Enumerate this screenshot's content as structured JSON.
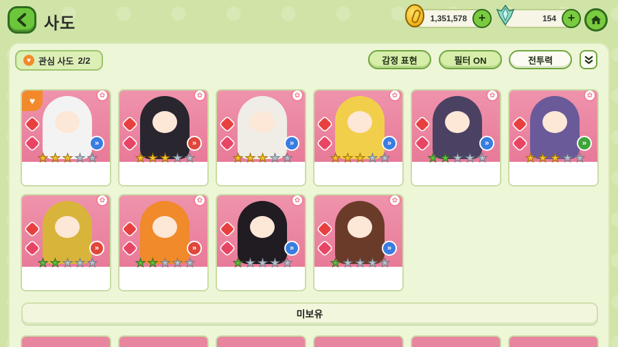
{
  "header": {
    "title": "사도",
    "coins": "1,351,578",
    "gems": "154",
    "plus_label": "+"
  },
  "toolbar": {
    "favorites_label": "관심 사도",
    "favorites_count": "2/2",
    "emotion_button": "감정 표현",
    "filter_button": "필터 ON",
    "power_button": "전투력"
  },
  "cards": [
    {
      "name": "",
      "stars": 3,
      "star_color": "gold",
      "favorite": true,
      "arrow": "blue"
    },
    {
      "name": "",
      "stars": 3,
      "star_color": "gold",
      "favorite": false,
      "arrow": "red"
    },
    {
      "name": "",
      "stars": 3,
      "star_color": "gold",
      "favorite": false,
      "arrow": "blue"
    },
    {
      "name": "",
      "stars": 3,
      "star_color": "gold",
      "favorite": false,
      "arrow": "blue"
    },
    {
      "name": "",
      "stars": 2,
      "star_color": "green",
      "favorite": false,
      "arrow": "blue"
    },
    {
      "name": "",
      "stars": 3,
      "star_color": "gold",
      "favorite": false,
      "arrow": "green"
    },
    {
      "name": "",
      "stars": 2,
      "star_color": "green",
      "favorite": false,
      "arrow": "red"
    },
    {
      "name": "",
      "stars": 2,
      "star_color": "green",
      "favorite": false,
      "arrow": "red"
    },
    {
      "name": "",
      "stars": 1,
      "star_color": "green",
      "favorite": false,
      "arrow": "blue"
    },
    {
      "name": "",
      "stars": 1,
      "star_color": "green",
      "favorite": false,
      "arrow": "blue"
    }
  ],
  "unowned_label": "미보유",
  "colors": {
    "accent_green": "#7acb3f",
    "card_pink": "#ef93ac",
    "star_gold": "#f6c232",
    "star_green": "#5ac23a"
  }
}
